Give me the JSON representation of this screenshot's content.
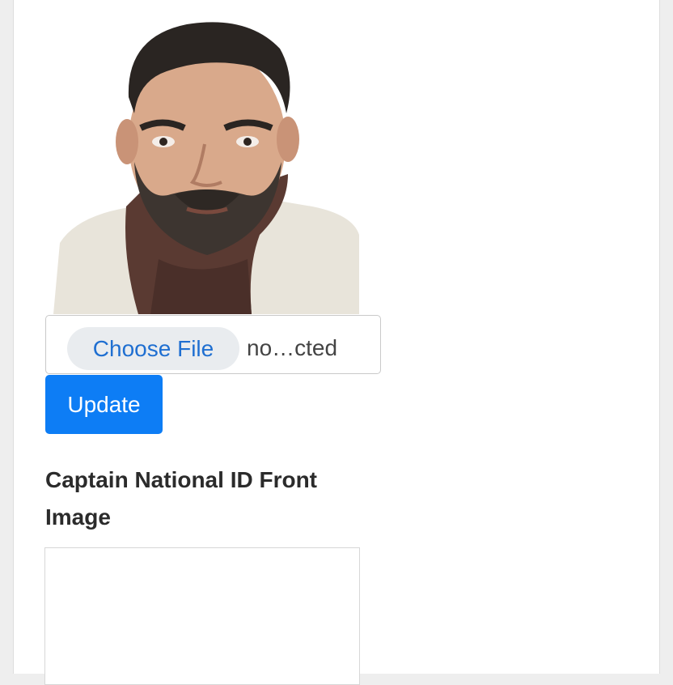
{
  "profile_photo": {
    "alt": "Captain profile photo"
  },
  "file_input": {
    "button_label": "Choose File",
    "file_name": "no…cted"
  },
  "update_button": {
    "label": "Update"
  },
  "national_id_section": {
    "title": "Captain National ID Front Image"
  },
  "colors": {
    "primary": "#0d7df5",
    "file_button_bg": "#e9ecef",
    "file_button_text": "#1f6fd1",
    "heading_text": "#2b2b2b"
  }
}
